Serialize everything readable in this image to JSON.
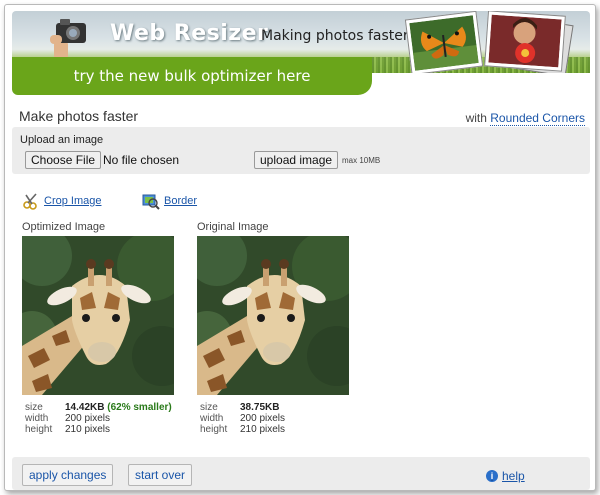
{
  "header": {
    "brand": "Web Resizer",
    "tagline": "Making photos faster",
    "promo": "try the new bulk optimizer here"
  },
  "page": {
    "title": "Make photos faster",
    "with_prefix": "with",
    "rounded_corners_link": "Rounded Corners"
  },
  "upload": {
    "label": "Upload an image",
    "choose_button": "Choose File",
    "file_status": "No file chosen",
    "upload_button": "upload image",
    "max_size": "max 10MB"
  },
  "tools": {
    "crop": "Crop Image",
    "border": "Border"
  },
  "optimized": {
    "label": "Optimized Image",
    "size_key": "size",
    "size": "14.42KB",
    "savings": "(62% smaller)",
    "width_key": "width",
    "width": "200 pixels",
    "height_key": "height",
    "height": "210 pixels"
  },
  "original": {
    "label": "Original Image",
    "size_key": "size",
    "size": "38.75KB",
    "width_key": "width",
    "width": "200 pixels",
    "height_key": "height",
    "height": "210 pixels"
  },
  "footer": {
    "apply": "apply changes",
    "start_over": "start over",
    "help": "help"
  },
  "colors": {
    "promo_green": "#6aa51a",
    "link_blue": "#1a55a8",
    "savings_green": "#2a7a1a"
  }
}
